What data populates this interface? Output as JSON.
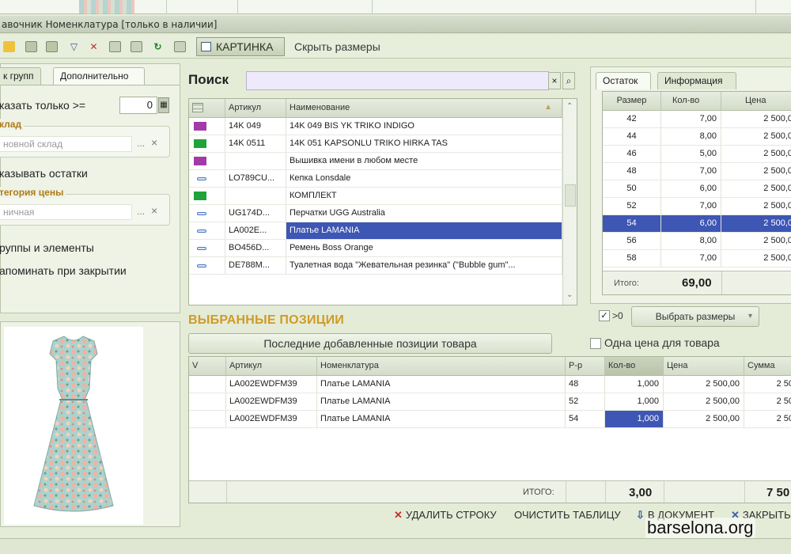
{
  "window": {
    "title": "авочник Номенклатура [только в наличии]"
  },
  "toolbar": {
    "kartinka_label": "КАРТИНКА",
    "hide_sizes_label": "Скрыть размеры"
  },
  "left": {
    "tabs": [
      "к групп",
      "Дополнительно"
    ],
    "show_only_label": "казать только  >=",
    "show_only_value": "0",
    "warehouse_title": "клад",
    "warehouse_value": "новной склад",
    "show_stock_label": "казывать остатки",
    "price_category_title": "тегория цены",
    "price_category_value": "ничная",
    "groups_elements_label": "руппы и элементы",
    "remember_label": "апоминать при закрытии",
    "clear_dots": "...",
    "clear_x": "×"
  },
  "search": {
    "label": "Поиск",
    "value": "",
    "clear_icon": "×",
    "find_icon": "⌕"
  },
  "products": {
    "columns": [
      "Артикул",
      "Наименование"
    ],
    "rows": [
      {
        "marker": "purple",
        "article": "14K 049",
        "name": "14K 049 BIS YK TRIKO INDIGO"
      },
      {
        "marker": "green",
        "article": "14K 0511",
        "name": "14K 051 KAPSONLU TRIKO HIRKA TAS"
      },
      {
        "marker": "purple",
        "article": "",
        "name": "Вышивка имени в любом месте"
      },
      {
        "marker": "dash",
        "article": "LO789CU...",
        "name": "Кепка Lonsdale"
      },
      {
        "marker": "green",
        "article": "",
        "name": "КОМПЛЕКТ"
      },
      {
        "marker": "dash",
        "article": "UG174D...",
        "name": "Перчатки UGG Australia"
      },
      {
        "marker": "dash",
        "article": "LA002E...",
        "name": "Платье LAMANIA"
      },
      {
        "marker": "dash",
        "article": "BO456D...",
        "name": "Ремень Boss Orange"
      },
      {
        "marker": "dash",
        "article": "DE788M...",
        "name": "Туалетная вода \"Жевательная резинка\" (\"Bubble gum\"..."
      }
    ]
  },
  "stock": {
    "tabs": [
      "Остаток",
      "Информация"
    ],
    "columns": [
      "Размер",
      "Кол-во",
      "Цена"
    ],
    "rows": [
      {
        "size": "42",
        "qty": "7,00",
        "price": "2 500,0"
      },
      {
        "size": "44",
        "qty": "8,00",
        "price": "2 500,0"
      },
      {
        "size": "46",
        "qty": "5,00",
        "price": "2 500,0"
      },
      {
        "size": "48",
        "qty": "7,00",
        "price": "2 500,0"
      },
      {
        "size": "50",
        "qty": "6,00",
        "price": "2 500,0"
      },
      {
        "size": "52",
        "qty": "7,00",
        "price": "2 500,0"
      },
      {
        "size": "54",
        "qty": "6,00",
        "price": "2 500,0"
      },
      {
        "size": "56",
        "qty": "8,00",
        "price": "2 500,0"
      },
      {
        "size": "58",
        "qty": "7,00",
        "price": "2 500,0"
      }
    ],
    "total_label": "Итого:",
    "total_value": "69,00",
    "gt_zero_label": ">0",
    "choose_sizes_label": "Выбрать размеры"
  },
  "selected": {
    "title": "ВЫБРАННЫЕ ПОЗИЦИИ",
    "recent_button": "Последние добавленные позиции товара",
    "one_price_label": "Одна цена для товара",
    "columns": [
      "V",
      "Артикул",
      "Номенклатура",
      "Р-р",
      "Кол-во",
      "Цена",
      "Сумма"
    ],
    "rows": [
      {
        "v": "",
        "article": "LA002EWDFM39",
        "name": "Платье LAMANIA",
        "size": "48",
        "qty": "1,000",
        "price": "2 500,00",
        "sum": "2 50"
      },
      {
        "v": "",
        "article": "LA002EWDFM39",
        "name": "Платье LAMANIA",
        "size": "52",
        "qty": "1,000",
        "price": "2 500,00",
        "sum": "2 50"
      },
      {
        "v": "",
        "article": "LA002EWDFM39",
        "name": "Платье LAMANIA",
        "size": "54",
        "qty": "1,000",
        "price": "2 500,00",
        "sum": "2 50"
      }
    ],
    "total_label": "ИТОГО:",
    "total_qty": "3,00",
    "total_sum": "7 50"
  },
  "actions": {
    "delete_row": "УДАЛИТЬ СТРОКУ",
    "clear_table": "ОЧИСТИТЬ ТАБЛИЦУ",
    "to_document": "В ДОКУМЕНТ",
    "close": "ЗАКРЫТЬ"
  },
  "watermark": "barselona.org",
  "colors": {
    "purple": "#a23aa8",
    "green": "#1fa33a",
    "dash": "#4a78c0",
    "selection": "#3e56b4",
    "accent": "#d09a28"
  }
}
